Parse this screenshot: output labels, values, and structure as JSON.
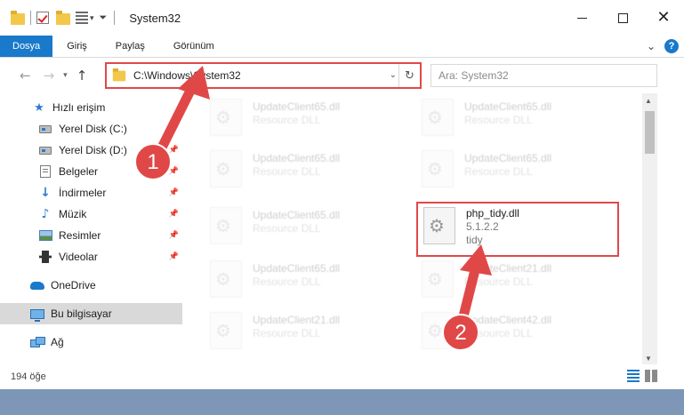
{
  "window": {
    "title": "System32"
  },
  "ribbon": {
    "tabs": [
      {
        "label": "Dosya"
      },
      {
        "label": "Giriş"
      },
      {
        "label": "Paylaş"
      },
      {
        "label": "Görünüm"
      }
    ]
  },
  "navbar": {
    "address": "C:\\Windows\\System32",
    "search_placeholder": "Ara: System32"
  },
  "sidebar": {
    "items": [
      {
        "label": "Hızlı erişim",
        "icon": "star-icon"
      },
      {
        "label": "Yerel Disk (C:)",
        "icon": "drive-icon"
      },
      {
        "label": "Yerel Disk (D:)",
        "icon": "drive-icon"
      },
      {
        "label": "Belgeler",
        "icon": "document-icon"
      },
      {
        "label": "İndirmeler",
        "icon": "download-icon"
      },
      {
        "label": "Müzik",
        "icon": "music-icon"
      },
      {
        "label": "Resimler",
        "icon": "pictures-icon"
      },
      {
        "label": "Videolar",
        "icon": "video-icon"
      },
      {
        "label": "OneDrive",
        "icon": "cloud-icon"
      },
      {
        "label": "Bu bilgisayar",
        "icon": "computer-icon"
      },
      {
        "label": "Ağ",
        "icon": "network-icon"
      }
    ]
  },
  "files": [
    {
      "name": "UpdateClient65.dll",
      "sub": "Resource DLL"
    },
    {
      "name": "UpdateClient65.dll",
      "sub": "Resource DLL"
    },
    {
      "name": "UpdateClient65.dll",
      "sub": "Resource DLL"
    },
    {
      "name": "UpdateClient65.dll",
      "sub": "Resource DLL"
    },
    {
      "name": "UpdateClient65.dll",
      "sub": "Resource DLL"
    },
    {
      "name": "php_tidy.dll",
      "version": "5.1.2.2",
      "sub": "tidy"
    },
    {
      "name": "UpdateClient65.dll",
      "sub": "Resource DLL"
    },
    {
      "name": "UpdateClient21.dll",
      "sub": "Resource DLL"
    },
    {
      "name": "UpdateClient21.dll",
      "sub": "Resource DLL"
    },
    {
      "name": "UpdateClient42.dll",
      "sub": "Resource DLL"
    }
  ],
  "status": {
    "count": "194 öğe"
  },
  "annotations": {
    "step1": "1",
    "step2": "2",
    "color": "#e04848"
  }
}
